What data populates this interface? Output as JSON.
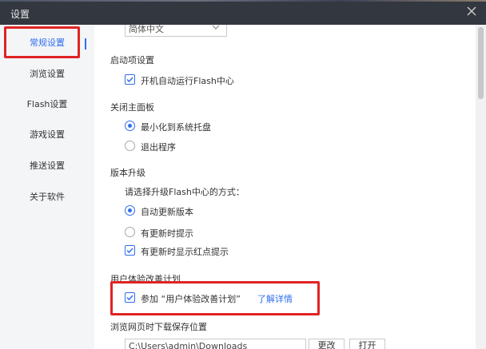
{
  "window": {
    "title": "设置"
  },
  "sidebar": {
    "items": [
      {
        "label": "常规设置",
        "active": true
      },
      {
        "label": "浏览设置"
      },
      {
        "label": "Flash设置"
      },
      {
        "label": "游戏设置"
      },
      {
        "label": "推送设置"
      },
      {
        "label": "关于软件"
      }
    ]
  },
  "language": {
    "selected": "简体中文"
  },
  "startup": {
    "heading": "启动项设置",
    "auto_start_label": "开机自动运行Flash中心",
    "auto_start_checked": true
  },
  "close_panel": {
    "heading": "关闭主面板",
    "options": [
      {
        "label": "最小化到系统托盘",
        "selected": true
      },
      {
        "label": "退出程序",
        "selected": false
      }
    ]
  },
  "upgrade": {
    "heading": "版本升级",
    "prompt": "请选择升级Flash中心的方式：",
    "options": [
      {
        "label": "自动更新版本",
        "selected": true
      },
      {
        "label": "有更新时提示",
        "selected": false
      }
    ],
    "red_dot_label": "有更新时显示红点提示",
    "red_dot_checked": true
  },
  "ux": {
    "heading": "用户体验改善计划",
    "join_label": "参加 “用户体验改善计划”",
    "join_checked": true,
    "learn_more": "了解详情"
  },
  "download": {
    "heading": "浏览网页时下载保存位置",
    "path": "C:\\Users\\admin\\Downloads",
    "change_label": "更改",
    "open_label": "打开"
  },
  "colors": {
    "accent": "#2f6ef0",
    "highlight": "#e02323",
    "titlebar": "#33373f"
  }
}
